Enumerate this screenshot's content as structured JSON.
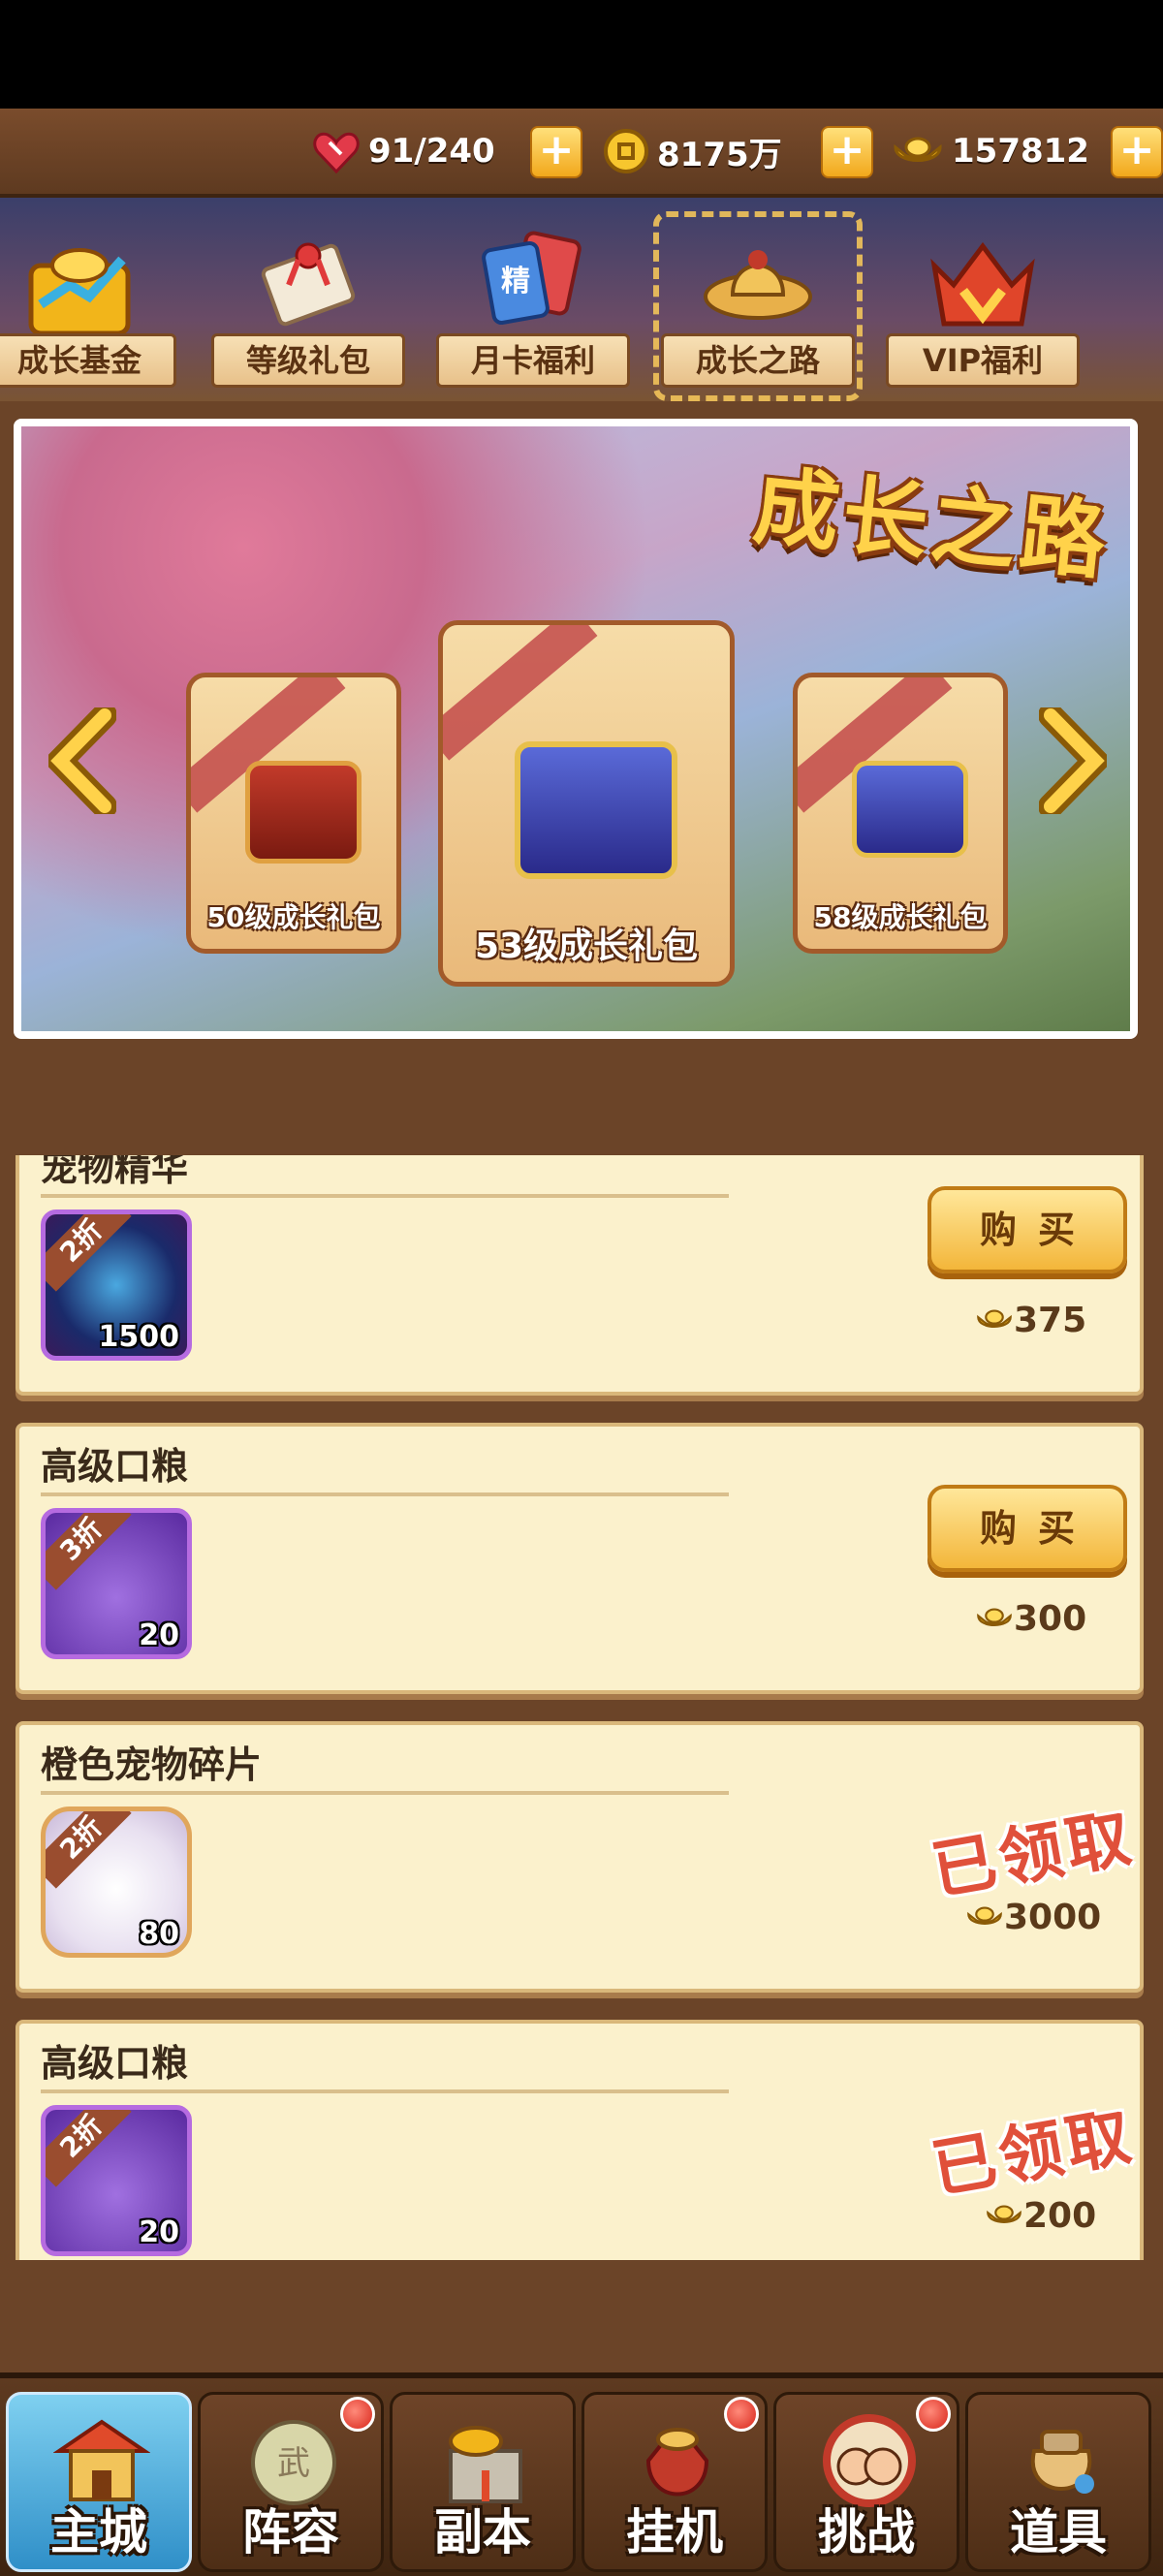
{
  "currency": {
    "stamina": "91/240",
    "coins": "8175万",
    "ingots": "157812",
    "plus_label": "+"
  },
  "tabs": [
    {
      "label": "成长基金",
      "icon": "growth-fund-icon"
    },
    {
      "label": "等级礼包",
      "icon": "scroll-icon"
    },
    {
      "label": "月卡福利",
      "icon": "month-card-icon",
      "badge": "精"
    },
    {
      "label": "成长之路",
      "icon": "straw-hat-icon",
      "selected": true
    },
    {
      "label": "VIP福利",
      "icon": "vip-crown-icon"
    }
  ],
  "banner": {
    "title": "成长之路",
    "packages": [
      {
        "label": "50级成长礼包"
      },
      {
        "label": "53级成长礼包",
        "selected": true
      },
      {
        "label": "58级成长礼包"
      }
    ]
  },
  "items": [
    {
      "title": "宠物精华",
      "discount": "2折",
      "qty": "1500",
      "price": "375",
      "status": "buy",
      "action_label": "购买"
    },
    {
      "title": "高级口粮",
      "discount": "3折",
      "qty": "20",
      "price": "300",
      "status": "buy",
      "action_label": "购买"
    },
    {
      "title": "橙色宠物碎片",
      "discount": "2折",
      "qty": "80",
      "price": "3000",
      "status": "claimed",
      "action_label": "已领取"
    },
    {
      "title": "高级口粮",
      "discount": "2折",
      "qty": "20",
      "price": "200",
      "status": "claimed",
      "action_label": "已领取"
    }
  ],
  "nav": [
    {
      "label": "主城",
      "active": true
    },
    {
      "label": "阵容",
      "dot": true
    },
    {
      "label": "副本"
    },
    {
      "label": "挂机",
      "dot": true
    },
    {
      "label": "挑战",
      "dot": true
    },
    {
      "label": "道具"
    }
  ],
  "colors": {
    "accent_gold": "#f2a81c",
    "claimed_red": "#e0503a",
    "purple_frame": "#b66be0"
  }
}
